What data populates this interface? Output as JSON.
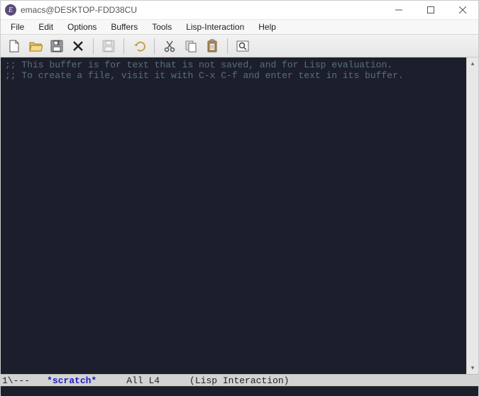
{
  "titlebar": {
    "title": "emacs@DESKTOP-FDD38CU"
  },
  "menubar": {
    "items": [
      "File",
      "Edit",
      "Options",
      "Buffers",
      "Tools",
      "Lisp-Interaction",
      "Help"
    ]
  },
  "toolbar": {
    "icons": {
      "new": "new-file-icon",
      "open": "open-folder-icon",
      "save": "save-icon",
      "close": "close-icon",
      "save_all": "save-all-icon",
      "undo": "undo-icon",
      "cut": "cut-icon",
      "copy": "copy-icon",
      "paste": "paste-icon",
      "search": "search-icon"
    }
  },
  "editor": {
    "line1": ";; This buffer is for text that is not saved, and for Lisp evaluation.",
    "line2": ";; To create a file, visit it with C-x C-f and enter text in its buffer."
  },
  "modeline": {
    "status": "1\\---",
    "buffer": "*scratch*",
    "position": "All L4",
    "mode": "(Lisp Interaction)"
  }
}
